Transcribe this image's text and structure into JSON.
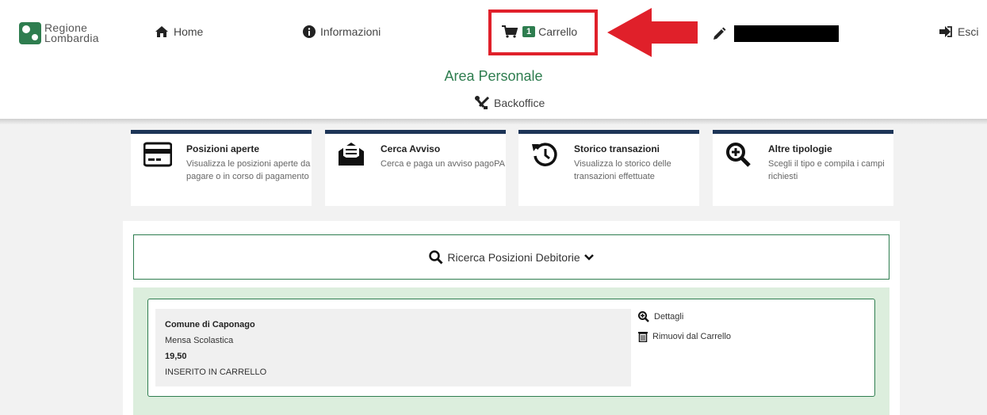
{
  "brand": {
    "line1": "Regione",
    "line2": "Lombardia"
  },
  "nav": {
    "home": "Home",
    "info": "Informazioni",
    "cart_count": "1",
    "cart": "Carrello",
    "logout": "Esci"
  },
  "header": {
    "title": "Area Personale",
    "backoffice": "Backoffice"
  },
  "cards": [
    {
      "title": "Posizioni aperte",
      "desc": "Visualizza le posizioni aperte da pagare o in corso di pagamento"
    },
    {
      "title": "Cerca Avviso",
      "desc": "Cerca e paga un avviso pagoPA"
    },
    {
      "title": "Storico transazioni",
      "desc": "Visualizza lo storico delle transazioni effettuate"
    },
    {
      "title": "Altre tipologie",
      "desc": "Scegli il tipo e compila i campi richiesti"
    }
  ],
  "search": {
    "label": "Ricerca Posizioni Debitorie"
  },
  "item": {
    "entity": "Comune di Caponago",
    "service": "Mensa Scolastica",
    "amount": "19,50",
    "status": "INSERITO IN CARRELLO",
    "details": "Dettagli",
    "remove": "Rimuovi dal Carrello"
  },
  "colors": {
    "brand_green": "#2e7d4f",
    "highlight_red": "#e0202a",
    "card_border": "#1d3557"
  }
}
